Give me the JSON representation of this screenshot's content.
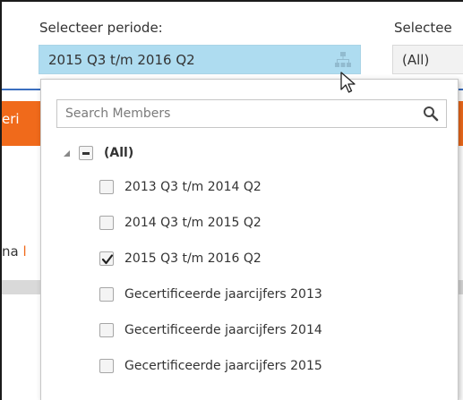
{
  "filters": {
    "period_label": "Selecteer periode:",
    "period_value": "2015 Q3 t/m 2016 Q2",
    "second_label": "Selectee",
    "second_value": "(All)"
  },
  "background": {
    "orange_text": "eri",
    "row_text_prefix": "na",
    "row_text_accent": "l"
  },
  "popup": {
    "search_placeholder": "Search Members",
    "root": {
      "label": "(All)",
      "state": "partial"
    },
    "items": [
      {
        "label": "2013 Q3 t/m 2014 Q2",
        "checked": false
      },
      {
        "label": "2014 Q3 t/m 2015 Q2",
        "checked": false
      },
      {
        "label": "2015 Q3 t/m 2016 Q2",
        "checked": true
      },
      {
        "label": "Gecertificeerde jaarcijfers 2013",
        "checked": false
      },
      {
        "label": "Gecertificeerde jaarcijfers 2014",
        "checked": false
      },
      {
        "label": "Gecertificeerde jaarcijfers 2015",
        "checked": false
      }
    ]
  },
  "colors": {
    "selected_slicer_bg": "#aedcf0",
    "accent_orange": "#f06a1b",
    "accent_blue": "#3b6fbf"
  },
  "icons": {
    "hierarchy": "hierarchy-icon",
    "search": "search-icon",
    "expander": "collapse-triangle-icon",
    "cursor": "mouse-pointer-icon"
  }
}
